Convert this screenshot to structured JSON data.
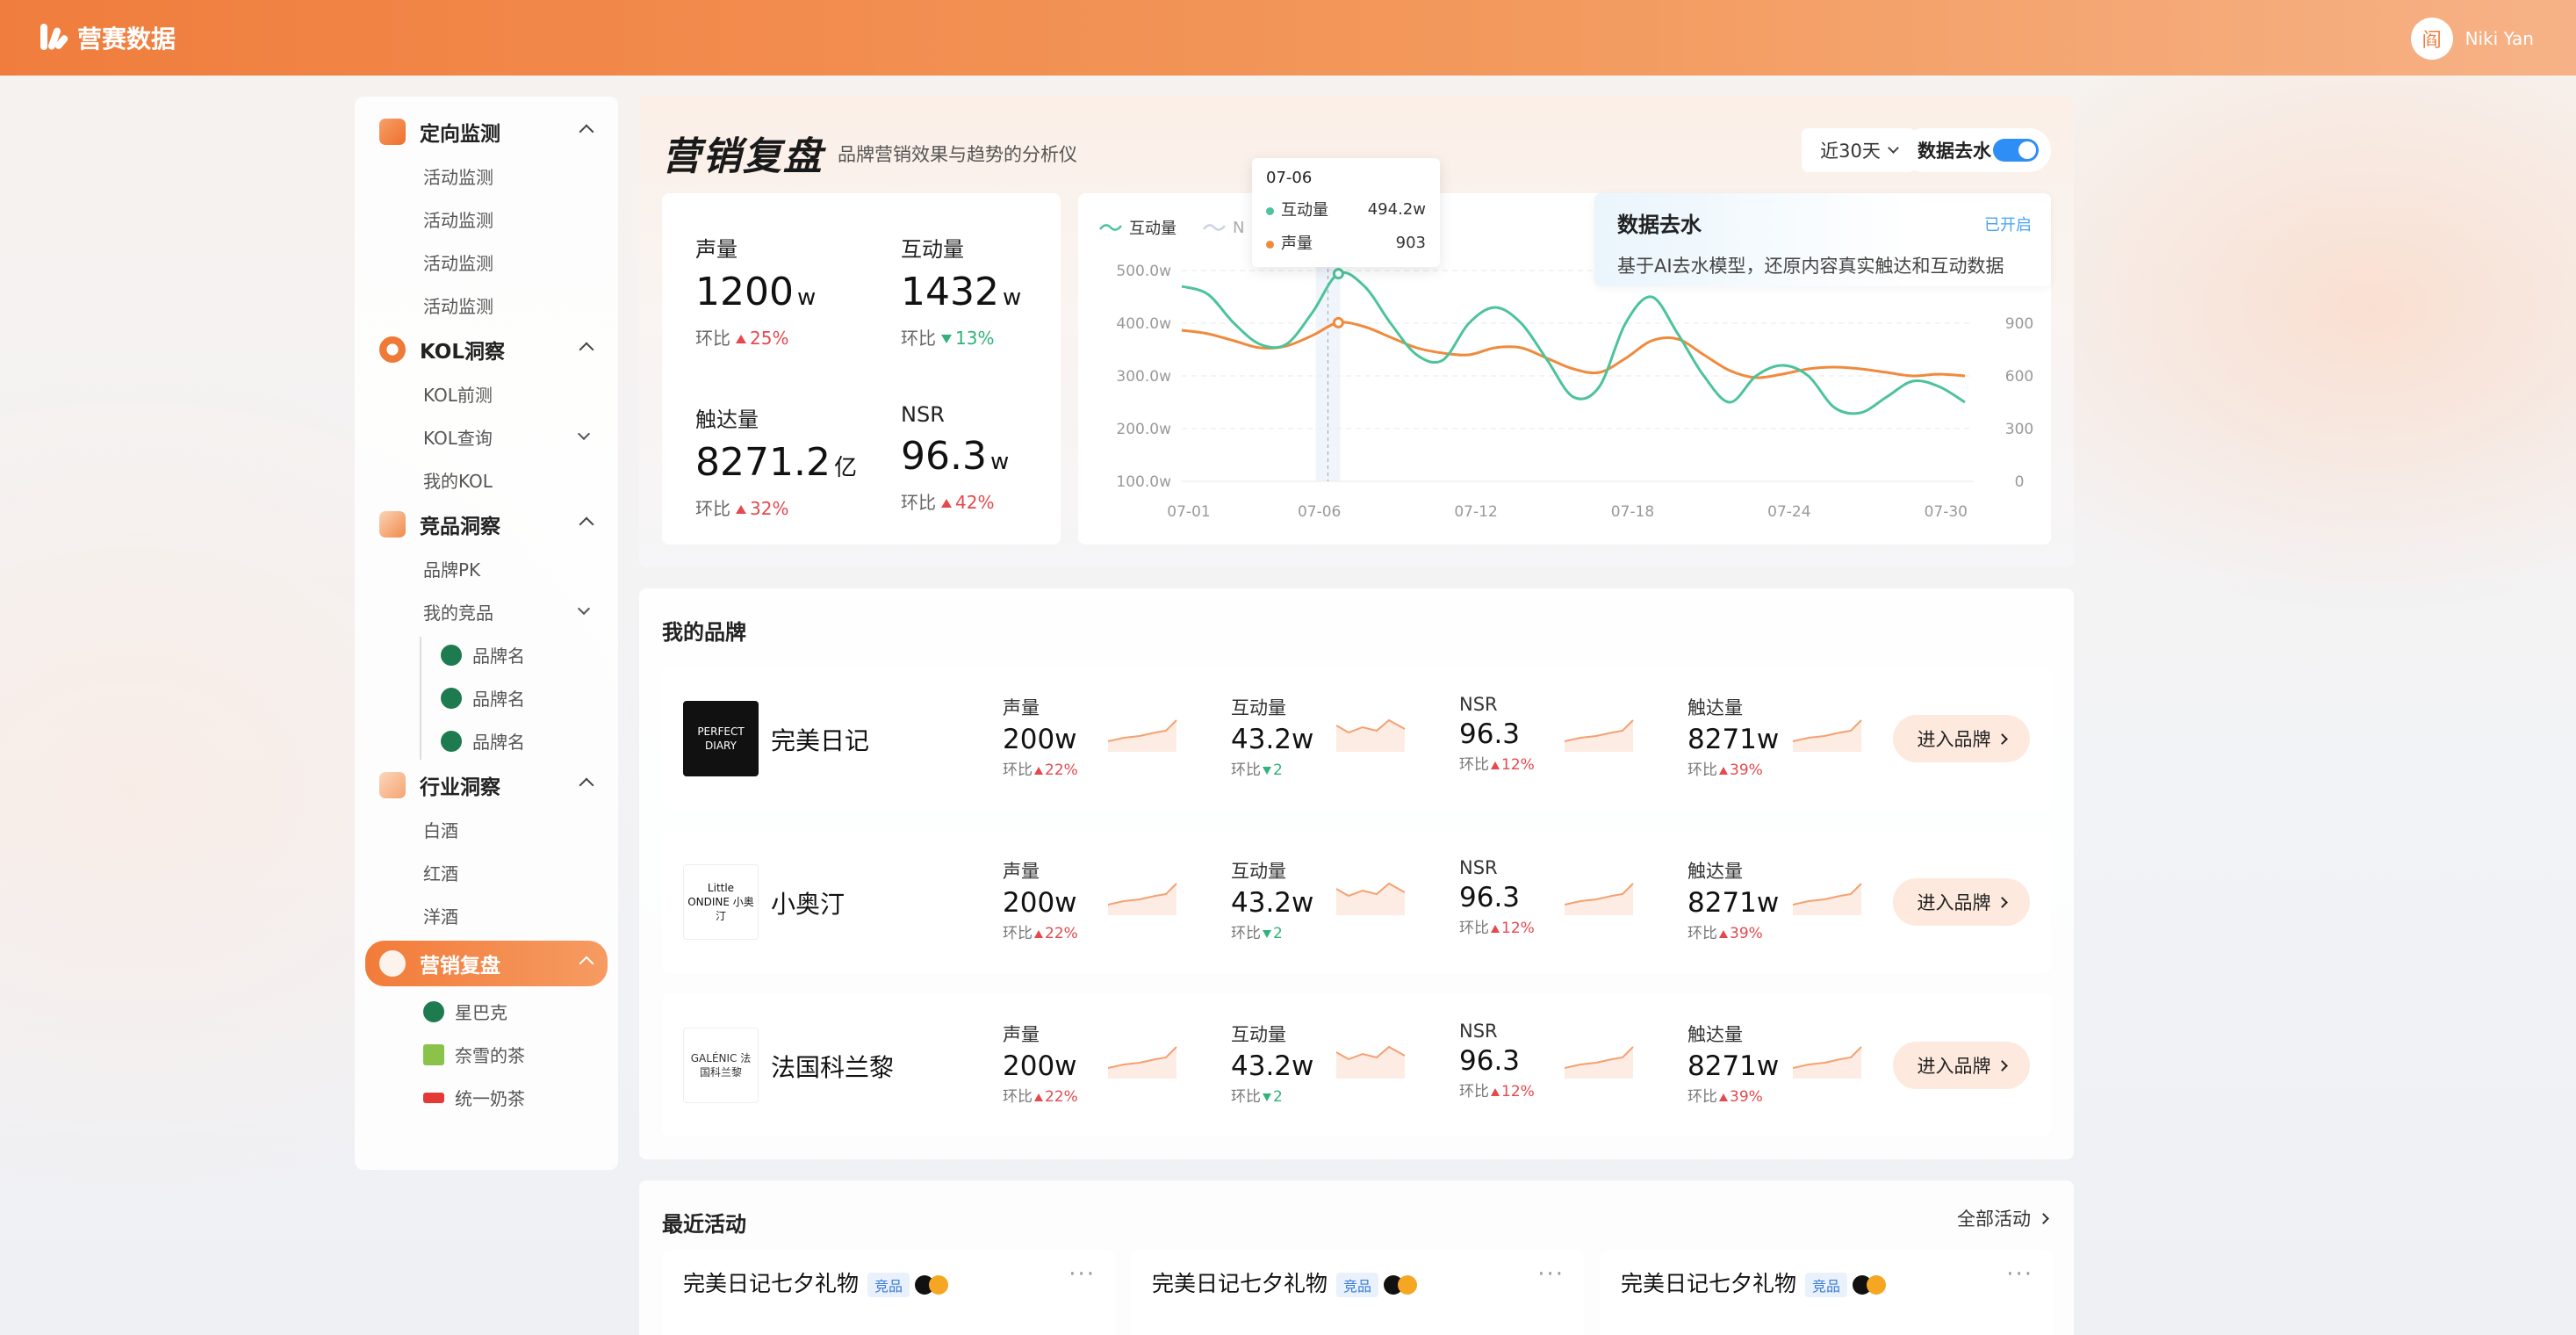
{
  "app": {
    "name": "营赛数据"
  },
  "user": {
    "avatar_char": "阎",
    "name": "Niki Yan"
  },
  "sidebar": {
    "groups": [
      {
        "label": "定向监测",
        "items": [
          "活动监测",
          "活动监测",
          "活动监测",
          "活动监测"
        ]
      },
      {
        "label": "KOL洞察",
        "items": [
          "KOL前测",
          "KOL查询",
          "我的KOL"
        ]
      },
      {
        "label": "竞品洞察",
        "items": [
          "品牌PK",
          "我的竞品"
        ],
        "subitems": [
          "品牌名",
          "品牌名",
          "品牌名"
        ]
      },
      {
        "label": "行业洞察",
        "items": [
          "白酒",
          "红酒",
          "洋酒"
        ]
      },
      {
        "label": "营销复盘",
        "items": [
          "星巴克",
          "奈雪的茶",
          "统一奶茶"
        ]
      }
    ]
  },
  "hero": {
    "title": "营销复盘",
    "subtitle": "品牌营销效果与趋势的分析仪",
    "range": "近30天",
    "dewater_toggle": "数据去水",
    "kpis": [
      {
        "label": "声量",
        "value": "1200",
        "unit": "w",
        "cmp_label": "环比",
        "cmp": "25%",
        "dir": "up"
      },
      {
        "label": "互动量",
        "value": "1432",
        "unit": "w",
        "cmp_label": "环比",
        "cmp": "13%",
        "dir": "down"
      },
      {
        "label": "触达量",
        "value": "8271.2",
        "unit": "亿",
        "cmp_label": "环比",
        "cmp": "32%",
        "dir": "up"
      },
      {
        "label": "NSR",
        "value": "96.3",
        "unit": "w",
        "cmp_label": "环比",
        "cmp": "42%",
        "dir": "up"
      }
    ],
    "popup": {
      "title": "数据去水",
      "status": "已开启",
      "desc": "基于AI去水模型，还原内容真实触达和互动数据"
    }
  },
  "chart_data": {
    "type": "line",
    "legend": [
      "互动量",
      "N"
    ],
    "x_ticks": [
      "07-01",
      "07-06",
      "07-12",
      "07-18",
      "07-24",
      "07-30"
    ],
    "y_left_ticks": [
      "500.0w",
      "400.0w",
      "300.0w",
      "200.0w",
      "100.0w"
    ],
    "y_right_ticks": [
      "900",
      "600",
      "300",
      "0"
    ],
    "ylim_left": [
      100,
      500
    ],
    "ylim_right": [
      0,
      1200
    ],
    "series": [
      {
        "name": "互动量",
        "color": "#4cc39b",
        "axis": "left",
        "x": [
          0,
          1,
          2,
          3,
          4,
          5,
          6,
          7,
          8,
          9,
          10,
          11,
          12,
          13,
          14,
          15,
          16,
          17,
          18,
          19,
          20,
          21,
          22,
          23,
          24,
          25,
          26,
          27,
          28,
          29,
          30
        ],
        "values": [
          470,
          455,
          400,
          360,
          360,
          420,
          494,
          470,
          400,
          340,
          330,
          400,
          430,
          400,
          330,
          260,
          280,
          400,
          450,
          380,
          300,
          250,
          300,
          320,
          300,
          240,
          230,
          260,
          290,
          280,
          250
        ]
      },
      {
        "name": "声量",
        "color": "#f08a3c",
        "axis": "right",
        "x": [
          0,
          1,
          2,
          3,
          4,
          5,
          6,
          7,
          8,
          9,
          10,
          11,
          12,
          13,
          14,
          15,
          16,
          17,
          18,
          19,
          20,
          21,
          22,
          23,
          24,
          25,
          26,
          27,
          28,
          29,
          30
        ],
        "values": [
          860,
          840,
          800,
          760,
          770,
          830,
          903,
          880,
          820,
          760,
          730,
          720,
          760,
          760,
          700,
          640,
          620,
          700,
          800,
          810,
          720,
          630,
          590,
          610,
          640,
          650,
          640,
          620,
          600,
          610,
          600
        ]
      }
    ],
    "tooltip": {
      "date": "07-06",
      "rows": [
        {
          "label": "互动量",
          "value": "494.2w"
        },
        {
          "label": "声量",
          "value": "903"
        }
      ]
    }
  },
  "brands": {
    "title": "我的品牌",
    "enter_label": "进入品牌",
    "metric_cmp_label": "环比",
    "rows": [
      {
        "name": "完美日记",
        "logo_text": "PERFECT DIARY",
        "metrics": [
          {
            "label": "声量",
            "value": "200w",
            "cmp": "22%",
            "dir": "up"
          },
          {
            "label": "互动量",
            "value": "43.2w",
            "cmp": "2",
            "dir": "down"
          },
          {
            "label": "NSR",
            "value": "96.3",
            "cmp": "12%",
            "dir": "up"
          },
          {
            "label": "触达量",
            "value": "8271w",
            "cmp": "39%",
            "dir": "up"
          }
        ]
      },
      {
        "name": "小奥汀",
        "logo_text": "Little ONDINE 小奥汀",
        "metrics": [
          {
            "label": "声量",
            "value": "200w",
            "cmp": "22%",
            "dir": "up"
          },
          {
            "label": "互动量",
            "value": "43.2w",
            "cmp": "2",
            "dir": "down"
          },
          {
            "label": "NSR",
            "value": "96.3",
            "cmp": "12%",
            "dir": "up"
          },
          {
            "label": "触达量",
            "value": "8271w",
            "cmp": "39%",
            "dir": "up"
          }
        ]
      },
      {
        "name": "法国科兰黎",
        "logo_text": "GALÉNIC 法国科兰黎",
        "metrics": [
          {
            "label": "声量",
            "value": "200w",
            "cmp": "22%",
            "dir": "up"
          },
          {
            "label": "互动量",
            "value": "43.2w",
            "cmp": "2",
            "dir": "down"
          },
          {
            "label": "NSR",
            "value": "96.3",
            "cmp": "12%",
            "dir": "up"
          },
          {
            "label": "触达量",
            "value": "8271w",
            "cmp": "39%",
            "dir": "up"
          }
        ]
      }
    ]
  },
  "activities": {
    "title": "最近活动",
    "all_label": "全部活动",
    "cards": [
      {
        "title": "完美日记七夕礼物",
        "tag": "竞品"
      },
      {
        "title": "完美日记七夕礼物",
        "tag": "竞品"
      },
      {
        "title": "完美日记七夕礼物",
        "tag": "竞品"
      }
    ]
  }
}
